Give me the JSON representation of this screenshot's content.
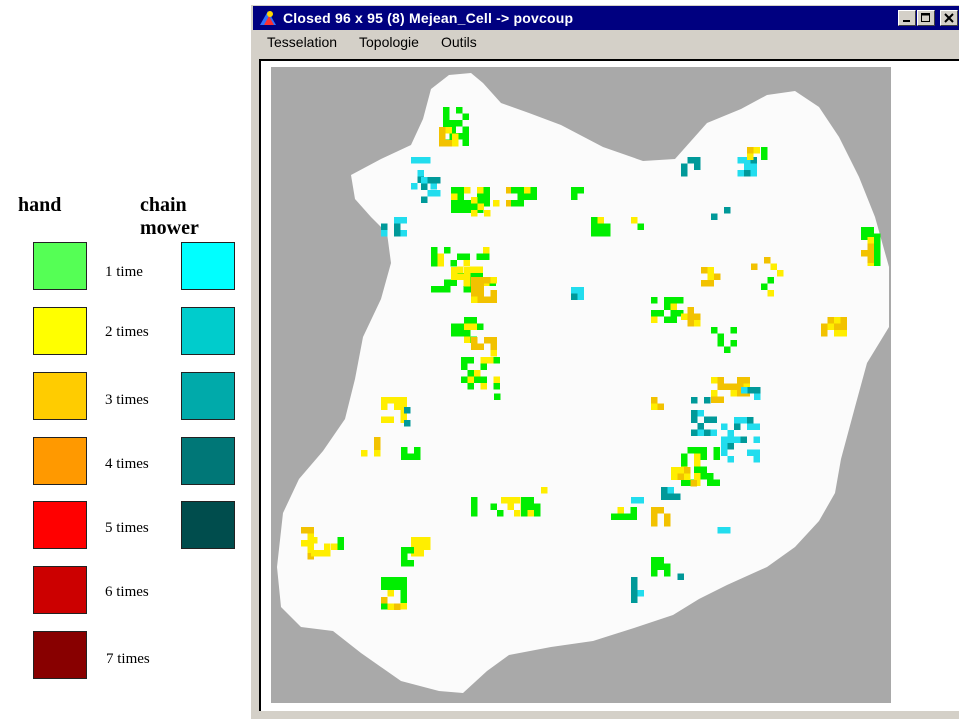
{
  "legend": {
    "hand_heading": "hand",
    "chain_heading": "chain mower",
    "hand_items": [
      {
        "label": "1 time",
        "color": "#55ff55"
      },
      {
        "label": "2 times",
        "color": "#ffff00"
      },
      {
        "label": "3 times",
        "color": "#ffcc00"
      },
      {
        "label": "4 times",
        "color": "#ff9900"
      },
      {
        "label": "5 times",
        "color": "#ff0000"
      },
      {
        "label": "6 times",
        "color": "#cc0000"
      },
      {
        "label": "7 times",
        "color": "#880000"
      }
    ],
    "chain_items": [
      {
        "color": "#00ffff"
      },
      {
        "color": "#00cccc"
      },
      {
        "color": "#00aaaa"
      },
      {
        "color": "#007777"
      },
      {
        "color": "#004d4d"
      }
    ]
  },
  "window": {
    "title": "Closed 96 x 95 (8)  Mejean_Cell -> povcoup",
    "app_icon": "app-icon",
    "minimize_icon": "minimize-icon",
    "maximize_icon": "maximize-icon",
    "close_icon": "close-icon",
    "menu": [
      "Tesselation",
      "Topologie",
      "Outils"
    ]
  },
  "map": {
    "background_color": "#a9a9a9",
    "study_area_color": "#fbfbfb",
    "hand_1_color": "#00ee00",
    "hand_2_color": "#ffee00",
    "hand_3_color": "#f2c200",
    "hand_4_color": "#f0a000",
    "chain_1_color": "#22ddee",
    "chain_2_color": "#009999"
  }
}
